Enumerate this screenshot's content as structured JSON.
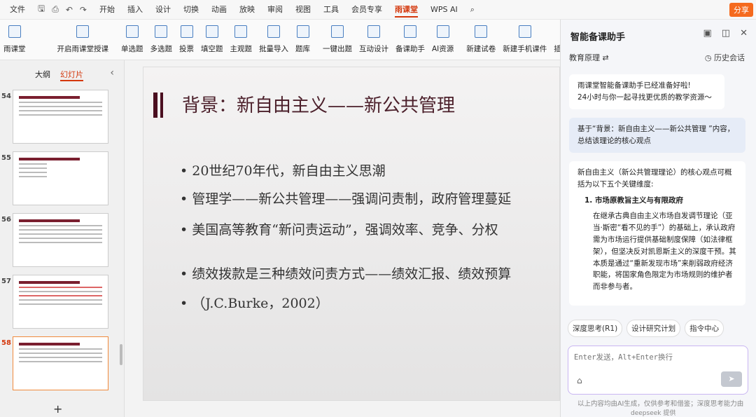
{
  "menubar": {
    "file": "文件",
    "items": [
      "开始",
      "插入",
      "设计",
      "切换",
      "动画",
      "放映",
      "审阅",
      "视图",
      "工具",
      "会员专享",
      "雨课堂",
      "WPS AI"
    ],
    "active_index": 10,
    "share": "分享"
  },
  "ribbon": {
    "buttons": [
      "雨课堂",
      "开启雨课堂授课",
      "单选题",
      "多选题",
      "投票",
      "填空题",
      "主观题",
      "批量导入",
      "题库",
      "一键出题",
      "互动设计",
      "备课助手",
      "AI资源",
      "新建试卷",
      "新建手机课件",
      "插入幕布"
    ]
  },
  "leftpanel": {
    "tab_outline": "大纲",
    "tab_slides": "幻灯片",
    "slides": [
      {
        "num": "54",
        "title": "",
        "selected": false
      },
      {
        "num": "55",
        "title": "",
        "selected": false
      },
      {
        "num": "56",
        "title": "",
        "selected": false
      },
      {
        "num": "57",
        "title": "",
        "selected": false
      },
      {
        "num": "58",
        "title": "",
        "selected": true
      }
    ],
    "add": "+"
  },
  "slide": {
    "title": "背景：新自由主义——新公共管理",
    "bullets": [
      "• 20世纪70年代，新自由主义思潮",
      "• 管理学——新公共管理——强调问责制，政府管理蔓延",
      "• 美国高等教育“新问责运动”，强调效率、竞争、分权",
      "• 绩效拨款是三种绩效问责方式——绩效汇报、绩效预算",
      "• （J.C.Burke，2002）"
    ]
  },
  "ai": {
    "title": "智能备课助手",
    "subject": "教育原理",
    "history": "历史会话",
    "greeting_line1": "雨课堂智能备课助手已经准备好啦!",
    "greeting_line2": "24小时与你一起寻找更优质的教学资源～",
    "user_msg": "基于“背景：新自由主义——新公共管理 ”内容，总结该理论的核心观点",
    "reply_intro": "新自由主义（新公共管理理论）的核心观点可概括为以下五个关键维度:",
    "reply_point": "1. 市场原教旨主义与有限政府",
    "reply_body": "在继承古典自由主义市场自发调节理论（亚当·斯密“看不见的手”）的基础上，承认政府需为市场运行提供基础制度保障（如法律框架），但坚决反对凯恩斯主义的深度干预。其本质是通过“重新发现市场”来削弱政府经济职能，将国家角色限定为市场规则的维护者而非参与者。",
    "chip1": "深度思考(R1)",
    "chip2": "设计研究计划",
    "chip3": "指令中心",
    "input_placeholder": "Enter发送，Alt+Enter换行",
    "disclaimer": "以上内容均由AI生成，仅供参考和借鉴；深度思考能力由",
    "provider": "deepseek 提供"
  }
}
